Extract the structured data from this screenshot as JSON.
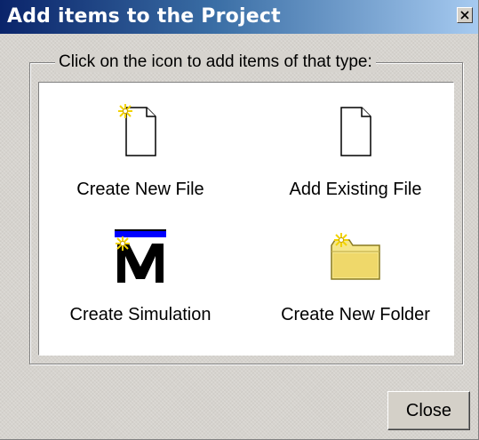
{
  "window": {
    "title": "Add items to the Project",
    "close_glyph": "X"
  },
  "group": {
    "legend": "Click on the icon to add items of that type:"
  },
  "items": [
    {
      "label": "Create New File",
      "icon": "new-file-icon"
    },
    {
      "label": "Add Existing File",
      "icon": "file-icon"
    },
    {
      "label": "Create Simulation",
      "icon": "simulation-icon"
    },
    {
      "label": "Create New Folder",
      "icon": "new-folder-icon"
    }
  ],
  "buttons": {
    "close_label": "Close"
  },
  "colors": {
    "title_start": "#0a246a",
    "title_end": "#a6caf0",
    "dialog_bg": "#d6d3ce",
    "panel_bg": "#ffffff",
    "sparkle": "#f2d200",
    "simulation_bar": "#0000ff",
    "folder": "#f5e68a"
  }
}
